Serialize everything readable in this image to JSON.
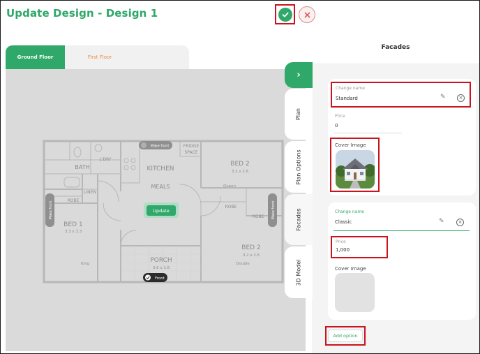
{
  "header": {
    "title": "Update Design - Design 1"
  },
  "floor_tabs": [
    {
      "label": "Ground Floor",
      "active": true
    },
    {
      "label": "First Floor",
      "active": false
    }
  ],
  "floorplan": {
    "rooms": {
      "bath": "BATH",
      "ldry": "L'DRY",
      "kitchen": "KITCHEN",
      "meals": "MEALS",
      "fridge_1": "FRIDGE",
      "fridge_2": "SPACE",
      "bed2_top": "BED 2",
      "bed2_top_size": "3.2 x 2.6",
      "bed2_top_type": "Queen",
      "linen": "LINEN",
      "robe_left": "ROBE",
      "robe_mid": "ROBE",
      "robe_right": "ROBE",
      "bed1": "BED 1",
      "bed1_size": "3.3 x 3.3",
      "bed1_type": "King",
      "porch": "PORCH",
      "porch_size": "3.6 x 1.6",
      "bed2_bottom": "BED 2",
      "bed2_bottom_size": "3.2 x 2.6",
      "bed2_bottom_type": "Double"
    },
    "make_front_top": "Make front",
    "make_front_left": "Make front",
    "make_front_right": "Make front",
    "update_label": "Update",
    "front_label": "Front"
  },
  "side_tabs": [
    {
      "label": "Plan",
      "active": false
    },
    {
      "label": "Plan Options",
      "active": false
    },
    {
      "label": "Facades",
      "active": true
    },
    {
      "label": "3D Model",
      "active": false
    }
  ],
  "panel": {
    "title": "Facades",
    "options": [
      {
        "name_label": "Change name",
        "name_value": "Standard",
        "price_label": "Price",
        "price_value": "0",
        "cover_label": "Cover Image",
        "has_image": true
      },
      {
        "name_label": "Change name",
        "name_value": "Classic",
        "price_label": "Price",
        "price_value": "1,000",
        "cover_label": "Cover Image",
        "has_image": false
      }
    ],
    "add_option_label": "Add option"
  },
  "colors": {
    "brand_green": "#2fa86a",
    "accent_orange": "#f08a3c",
    "highlight_red": "#c8141e"
  }
}
